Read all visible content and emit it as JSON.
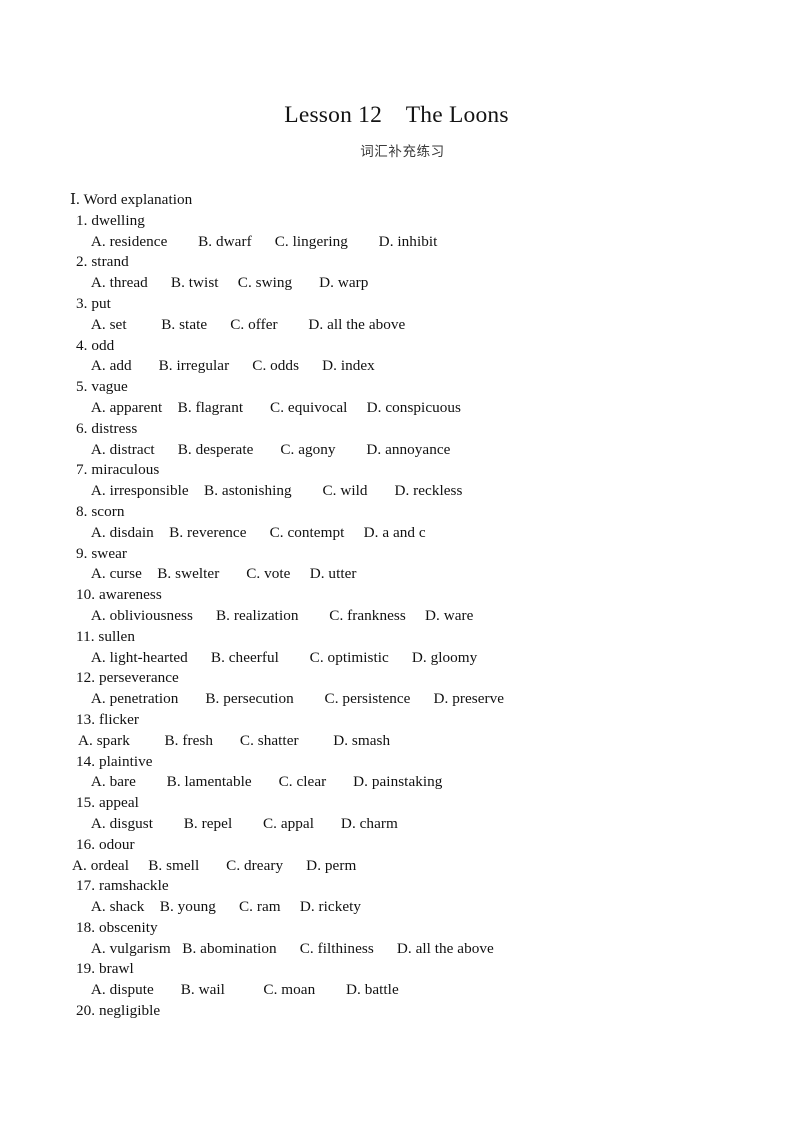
{
  "document": {
    "title": "Lesson 12　The Loons",
    "subtitle": "词汇补充练习",
    "section_heading": "Ⅰ. Word explanation",
    "last_line": "20. negligible"
  },
  "colors": {
    "page_background": "#ffffff",
    "body_text": "#111111",
    "title_text": "#141414",
    "subtitle_text": "#3a3a3a"
  },
  "questions": [
    {
      "number": "1.",
      "word_line": "1. dwelling",
      "options_line": "  A. residence        B. dwarf      C. lingering        D. inhibit",
      "indent": "normal"
    },
    {
      "number": "2.",
      "word_line": "2. strand",
      "options_line": "  A. thread      B. twist     C. swing       D. warp",
      "indent": "normal"
    },
    {
      "number": "3.",
      "word_line": "3. put",
      "options_line": "  A. set         B. state      C. offer        D. all the above",
      "indent": "normal"
    },
    {
      "number": "4.",
      "word_line": "4. odd",
      "options_line": "  A. add       B. irregular      C. odds      D. index",
      "indent": "normal"
    },
    {
      "number": "5.",
      "word_line": "5. vague",
      "options_line": "  A. apparent    B. flagrant       C. equivocal     D. conspicuous",
      "indent": "normal"
    },
    {
      "number": "6.",
      "word_line": "6. distress",
      "options_line": "  A. distract      B. desperate       C. agony        D. annoyance",
      "indent": "normal"
    },
    {
      "number": "7.",
      "word_line": "7. miraculous",
      "options_line": "  A. irresponsible    B. astonishing        C. wild       D. reckless",
      "indent": "normal"
    },
    {
      "number": "8.",
      "word_line": "8. scorn",
      "options_line": "  A. disdain    B. reverence      C. contempt     D. a and c",
      "indent": "normal"
    },
    {
      "number": "9.",
      "word_line": "9. swear",
      "options_line": "  A. curse    B. swelter       C. vote     D. utter",
      "indent": "normal"
    },
    {
      "number": "10.",
      "word_line": "10. awareness",
      "options_line": "  A. obliviousness      B. realization        C. frankness     D. ware",
      "indent": "normal"
    },
    {
      "number": "11.",
      "word_line": "11. sullen",
      "options_line": "  A. light-hearted      B. cheerful        C. optimistic      D. gloomy",
      "indent": "normal"
    },
    {
      "number": "12.",
      "word_line": "12. perseverance",
      "options_line": "  A. penetration       B. persecution        C. persistence      D. preserve",
      "indent": "normal"
    },
    {
      "number": "13.",
      "word_line": "13. flicker",
      "options_line": "A. spark         B. fresh       C. shatter         D. smash",
      "indent": "semi"
    },
    {
      "number": "14.",
      "word_line": "14. plaintive",
      "options_line": "  A. bare        B. lamentable       C. clear       D. painstaking",
      "indent": "normal"
    },
    {
      "number": "15.",
      "word_line": "15. appeal",
      "options_line": "  A. disgust        B. repel        C. appal       D. charm",
      "indent": "normal"
    },
    {
      "number": "16.",
      "word_line": "16. odour",
      "options_line": "A. ordeal     B. smell       C. dreary      D. perm",
      "indent": "flush"
    },
    {
      "number": "17.",
      "word_line": "17. ramshackle",
      "options_line": "  A. shack    B. young      C. ram     D. rickety",
      "indent": "normal"
    },
    {
      "number": "18.",
      "word_line": "18. obscenity",
      "options_line": "  A. vulgarism   B. abomination      C. filthiness      D. all the above",
      "indent": "normal"
    },
    {
      "number": "19.",
      "word_line": "19. brawl",
      "options_line": "  A. dispute       B. wail          C. moan        D. battle",
      "indent": "normal"
    },
    {
      "number": "20.",
      "word_line": "20. negligible",
      "options_line": "",
      "indent": "normal"
    }
  ]
}
